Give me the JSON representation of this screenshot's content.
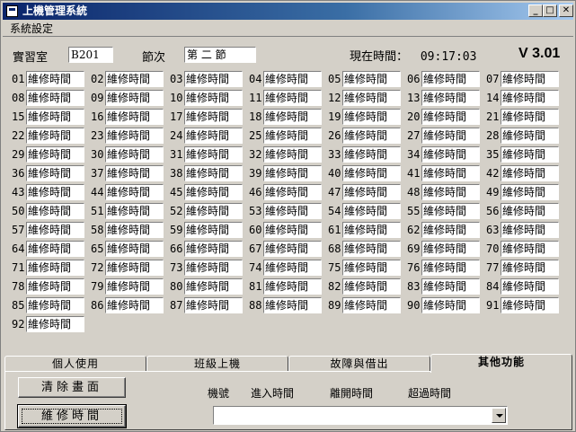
{
  "window": {
    "title": "上機管理系統",
    "controls": {
      "minimize": "_",
      "maximize": "□",
      "close": "✕"
    }
  },
  "menu": {
    "items": [
      "系統設定"
    ]
  },
  "header": {
    "room_label": "實習室",
    "room_value": "B201",
    "period_label": "節次",
    "period_value": "第 二 節",
    "time_label": "現在時間：",
    "time_value": "09:17:03",
    "version": "V 3.01"
  },
  "machines": [
    {
      "num": "01",
      "status": "維修時間"
    },
    {
      "num": "02",
      "status": "維修時間"
    },
    {
      "num": "03",
      "status": "維修時間"
    },
    {
      "num": "04",
      "status": "維修時間"
    },
    {
      "num": "05",
      "status": "維修時間"
    },
    {
      "num": "06",
      "status": "維修時間"
    },
    {
      "num": "07",
      "status": "維修時間"
    },
    {
      "num": "08",
      "status": "維修時間"
    },
    {
      "num": "09",
      "status": "維修時間"
    },
    {
      "num": "10",
      "status": "維修時間"
    },
    {
      "num": "11",
      "status": "維修時間"
    },
    {
      "num": "12",
      "status": "維修時間"
    },
    {
      "num": "13",
      "status": "維修時間"
    },
    {
      "num": "14",
      "status": "維修時間"
    },
    {
      "num": "15",
      "status": "維修時間"
    },
    {
      "num": "16",
      "status": "維修時間"
    },
    {
      "num": "17",
      "status": "維修時間"
    },
    {
      "num": "18",
      "status": "維修時間"
    },
    {
      "num": "19",
      "status": "維修時間"
    },
    {
      "num": "20",
      "status": "維修時間"
    },
    {
      "num": "21",
      "status": "維修時間"
    },
    {
      "num": "22",
      "status": "維修時間"
    },
    {
      "num": "23",
      "status": "維修時間"
    },
    {
      "num": "24",
      "status": "維修時間"
    },
    {
      "num": "25",
      "status": "維修時間"
    },
    {
      "num": "26",
      "status": "維修時間"
    },
    {
      "num": "27",
      "status": "維修時間"
    },
    {
      "num": "28",
      "status": "維修時間"
    },
    {
      "num": "29",
      "status": "維修時間"
    },
    {
      "num": "30",
      "status": "維修時間"
    },
    {
      "num": "31",
      "status": "維修時間"
    },
    {
      "num": "32",
      "status": "維修時間"
    },
    {
      "num": "33",
      "status": "維修時間"
    },
    {
      "num": "34",
      "status": "維修時間"
    },
    {
      "num": "35",
      "status": "維修時間"
    },
    {
      "num": "36",
      "status": "維修時間"
    },
    {
      "num": "37",
      "status": "維修時間"
    },
    {
      "num": "38",
      "status": "維修時間"
    },
    {
      "num": "39",
      "status": "維修時間"
    },
    {
      "num": "40",
      "status": "維修時間"
    },
    {
      "num": "41",
      "status": "維修時間"
    },
    {
      "num": "42",
      "status": "維修時間"
    },
    {
      "num": "43",
      "status": "維修時間"
    },
    {
      "num": "44",
      "status": "維修時間"
    },
    {
      "num": "45",
      "status": "維修時間"
    },
    {
      "num": "46",
      "status": "維修時間"
    },
    {
      "num": "47",
      "status": "維修時間"
    },
    {
      "num": "48",
      "status": "維修時間"
    },
    {
      "num": "49",
      "status": "維修時間"
    },
    {
      "num": "50",
      "status": "維修時間"
    },
    {
      "num": "51",
      "status": "維修時間"
    },
    {
      "num": "52",
      "status": "維修時間"
    },
    {
      "num": "53",
      "status": "維修時間"
    },
    {
      "num": "54",
      "status": "維修時間"
    },
    {
      "num": "55",
      "status": "維修時間"
    },
    {
      "num": "56",
      "status": "維修時間"
    },
    {
      "num": "57",
      "status": "維修時間"
    },
    {
      "num": "58",
      "status": "維修時間"
    },
    {
      "num": "59",
      "status": "維修時間"
    },
    {
      "num": "60",
      "status": "維修時間"
    },
    {
      "num": "61",
      "status": "維修時間"
    },
    {
      "num": "62",
      "status": "維修時間"
    },
    {
      "num": "63",
      "status": "維修時間"
    },
    {
      "num": "64",
      "status": "維修時間"
    },
    {
      "num": "65",
      "status": "維修時間"
    },
    {
      "num": "66",
      "status": "維修時間"
    },
    {
      "num": "67",
      "status": "維修時間"
    },
    {
      "num": "68",
      "status": "維修時間"
    },
    {
      "num": "69",
      "status": "維修時間"
    },
    {
      "num": "70",
      "status": "維修時間"
    },
    {
      "num": "71",
      "status": "維修時間"
    },
    {
      "num": "72",
      "status": "維修時間"
    },
    {
      "num": "73",
      "status": "維修時間"
    },
    {
      "num": "74",
      "status": "維修時間"
    },
    {
      "num": "75",
      "status": "維修時間"
    },
    {
      "num": "76",
      "status": "維修時間"
    },
    {
      "num": "77",
      "status": "維修時間"
    },
    {
      "num": "78",
      "status": "維修時間"
    },
    {
      "num": "79",
      "status": "維修時間"
    },
    {
      "num": "80",
      "status": "維修時間"
    },
    {
      "num": "81",
      "status": "維修時間"
    },
    {
      "num": "82",
      "status": "維修時間"
    },
    {
      "num": "83",
      "status": "維修時間"
    },
    {
      "num": "84",
      "status": "維修時間"
    },
    {
      "num": "85",
      "status": "維修時間"
    },
    {
      "num": "86",
      "status": "維修時間"
    },
    {
      "num": "87",
      "status": "維修時間"
    },
    {
      "num": "88",
      "status": "維修時間"
    },
    {
      "num": "89",
      "status": "維修時間"
    },
    {
      "num": "90",
      "status": "維修時間"
    },
    {
      "num": "91",
      "status": "維修時間"
    },
    {
      "num": "92",
      "status": "維修時間"
    }
  ],
  "tabs": [
    "個人使用",
    "班級上機",
    "故障與借出",
    "其他功能"
  ],
  "active_tab": 3,
  "panel": {
    "clear_button": "清除畫面",
    "repair_button": "維修時間",
    "columns": [
      "機號",
      "進入時間",
      "離開時間",
      "超過時間"
    ],
    "combo_value": ""
  },
  "colors": {
    "face": "#d4d0c8",
    "title_start": "#0a246a",
    "title_end": "#a6caf0"
  }
}
